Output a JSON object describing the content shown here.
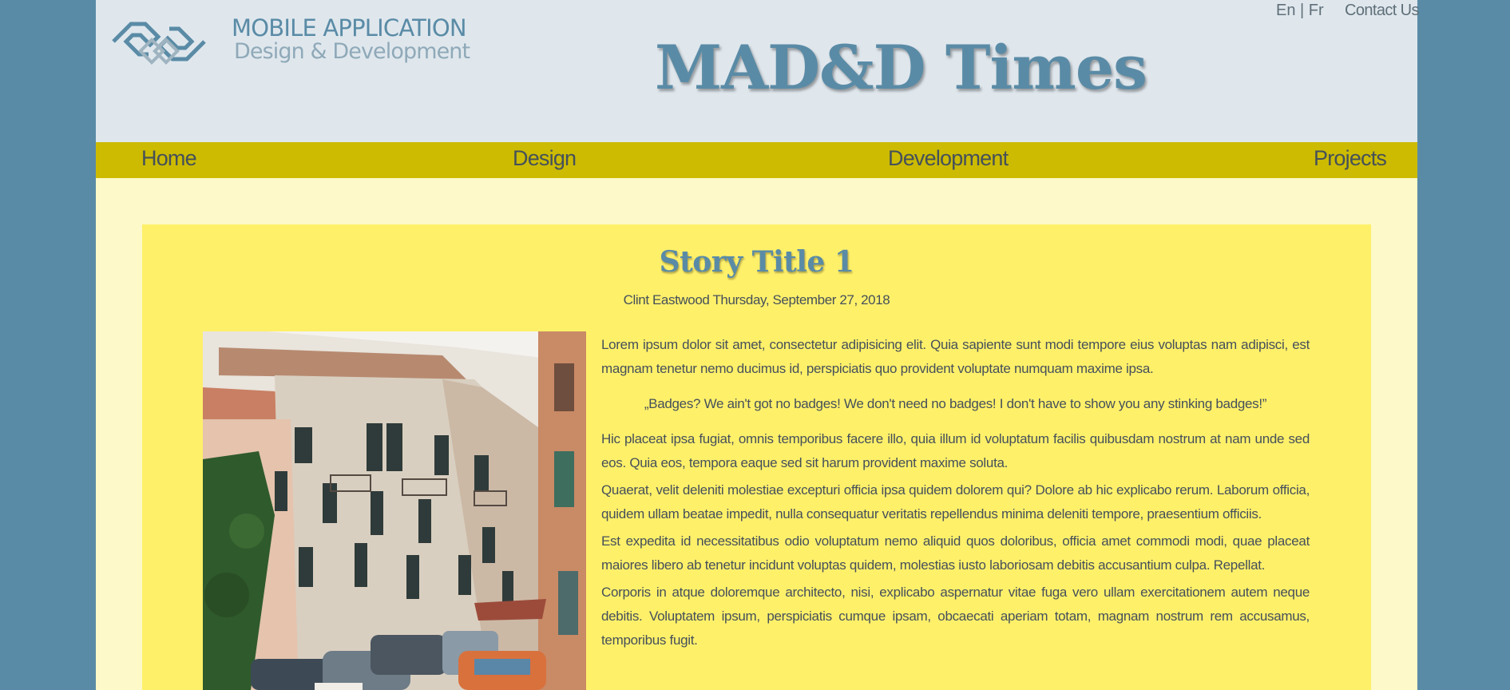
{
  "header": {
    "logo_line1": "MOBILE APPLICATION",
    "logo_line2": "Design & Development",
    "lang_switch": "En | Fr",
    "contact": "Contact Us",
    "site_title": "MAD&D Times"
  },
  "nav": {
    "items": [
      {
        "label": "Home"
      },
      {
        "label": "Design"
      },
      {
        "label": "Development"
      },
      {
        "label": "Projects"
      }
    ]
  },
  "story": {
    "title": "Story Title 1",
    "byline": "Clint Eastwood Thursday, September 27, 2018",
    "paragraph1": "Lorem ipsum dolor sit amet, consectetur adipisicing elit. Quia sapiente sunt modi tempore eius voluptas nam adipisci, est magnam tenetur nemo ducimus id, perspiciatis quo provident voluptate numquam maxime ipsa.",
    "quote": "„Badges? We ain't got no badges! We don't need no badges! I don't have to show you any stinking badges!”",
    "paragraph2": "Hic placeat ipsa fugiat, omnis temporibus facere illo, quia illum id voluptatum facilis quibusdam nostrum at nam unde sed eos. Quia eos, tempora eaque sed sit harum provident maxime soluta.",
    "paragraph3": "Quaerat, velit deleniti molestiae excepturi officia ipsa quidem dolorem qui? Dolore ab hic explicabo rerum. Laborum officia, quidem ullam beatae impedit, nulla consequatur veritatis repellendus minima deleniti tempore, praesentium officiis.",
    "paragraph4": "Est expedita id necessitatibus odio voluptatum nemo aliquid quos doloribus, officia amet commodi modi, quae placeat maiores libero ab tenetur incidunt voluptas quidem, molestias iusto laboriosam debitis accusantium culpa. Repellat.",
    "paragraph5": "Corporis in atque doloremque architecto, nisi, explicabo aspernatur vitae fuga vero ullam exercitationem autem neque debitis. Voluptatem ipsum, perspiciatis cumque ipsam, obcaecati aperiam totam, magnam nostrum rem accusamus, temporibus fugit."
  },
  "colors": {
    "outer_background": "#5a8ba6",
    "header_background": "#dfe7ed",
    "nav_background": "#ccbb00",
    "page_background": "#fdf9c8",
    "story_background": "#fff06a",
    "accent": "#5a8ba6"
  }
}
